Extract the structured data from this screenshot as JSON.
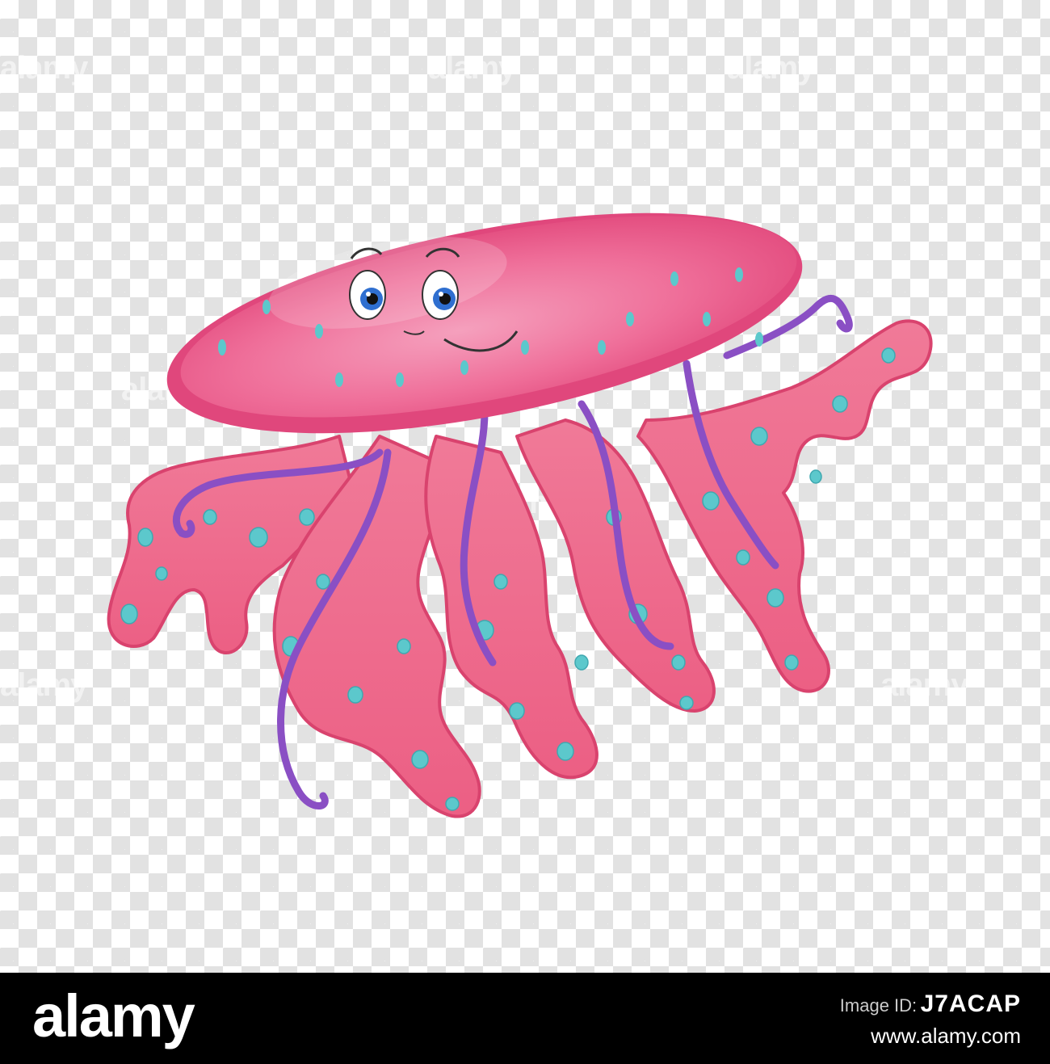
{
  "watermark": {
    "text": "alamy"
  },
  "footer": {
    "logo_text": "alamy",
    "image_id_label": "Image ID:",
    "image_id": "J7ACAP",
    "site": "www.alamy.com"
  },
  "colors": {
    "bell_pink": "#ef5a8c",
    "tentacle_pink": "#f06b8c",
    "spot_cyan": "#5cc8cc",
    "string_purple": "#8a4fc4",
    "eye_blue": "#2f6fd0"
  }
}
